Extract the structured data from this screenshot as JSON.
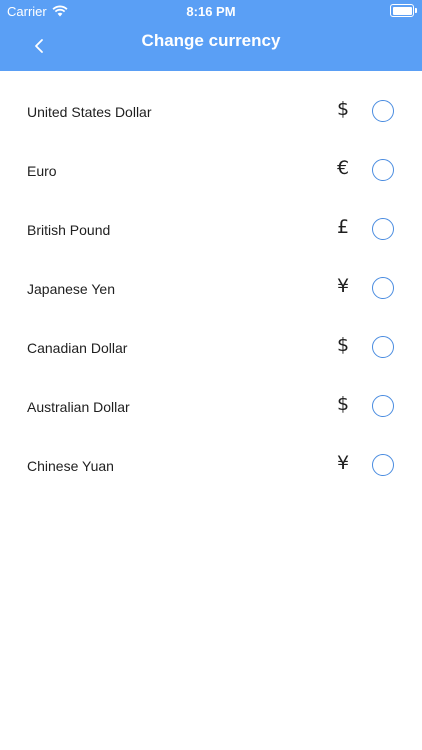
{
  "status": {
    "carrier": "Carrier",
    "time": "8:16 PM"
  },
  "nav": {
    "title": "Change currency",
    "back_icon": "chevron-left-icon"
  },
  "colors": {
    "header_bg": "#5a9ff5",
    "radio_border": "#4a8ce0"
  },
  "currencies": [
    {
      "name": "United States Dollar",
      "symbol": "$",
      "selected": false
    },
    {
      "name": "Euro",
      "symbol": "€",
      "selected": false
    },
    {
      "name": "British Pound",
      "symbol": "£",
      "selected": false
    },
    {
      "name": "Japanese Yen",
      "symbol": "¥",
      "selected": false
    },
    {
      "name": "Canadian Dollar",
      "symbol": "$",
      "selected": false
    },
    {
      "name": "Australian Dollar",
      "symbol": "$",
      "selected": false
    },
    {
      "name": "Chinese Yuan",
      "symbol": "¥",
      "selected": false
    }
  ]
}
